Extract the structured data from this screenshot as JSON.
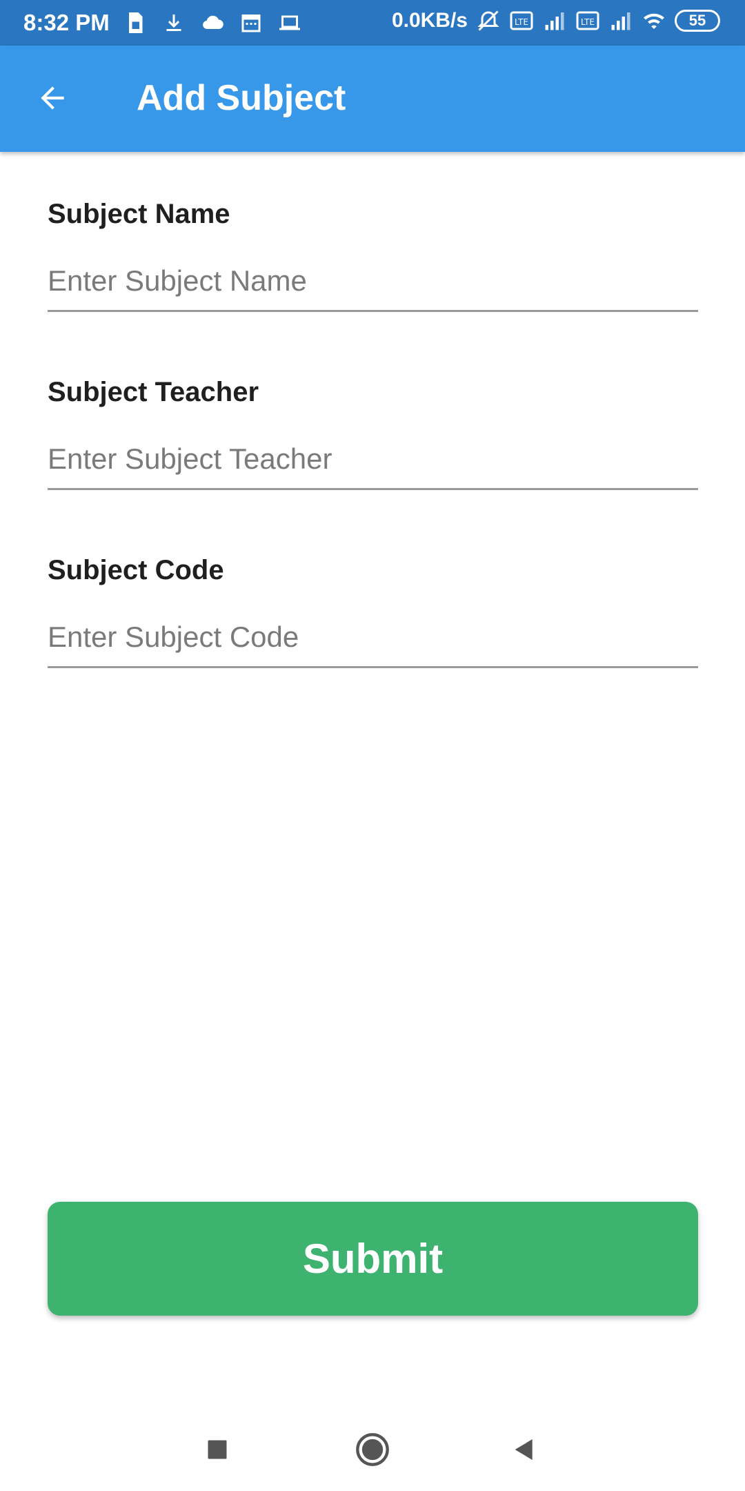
{
  "status_bar": {
    "time": "8:32 PM",
    "network_speed": "0.0KB/s",
    "battery_level": "55",
    "left_icons": [
      "sim-card-icon",
      "download-icon",
      "cloud-icon",
      "calendar-icon",
      "laptop-icon"
    ],
    "right_icons": [
      "muted-alarm-icon",
      "volte-icon",
      "signal-icon",
      "volte-icon",
      "signal-icon",
      "wifi-icon"
    ]
  },
  "app_bar": {
    "title": "Add Subject",
    "back_icon": "arrow-back-icon",
    "color": "#3797e8"
  },
  "form": {
    "fields": [
      {
        "label": "Subject Name",
        "placeholder": "Enter Subject Name",
        "value": ""
      },
      {
        "label": "Subject Teacher",
        "placeholder": "Enter Subject Teacher",
        "value": ""
      },
      {
        "label": "Subject Code",
        "placeholder": "Enter Subject Code",
        "value": ""
      }
    ]
  },
  "submit_button": {
    "label": "Submit",
    "color": "#3eb370"
  },
  "nav_bar": {
    "icons": [
      "recents-square-icon",
      "home-circle-icon",
      "back-triangle-icon"
    ]
  }
}
